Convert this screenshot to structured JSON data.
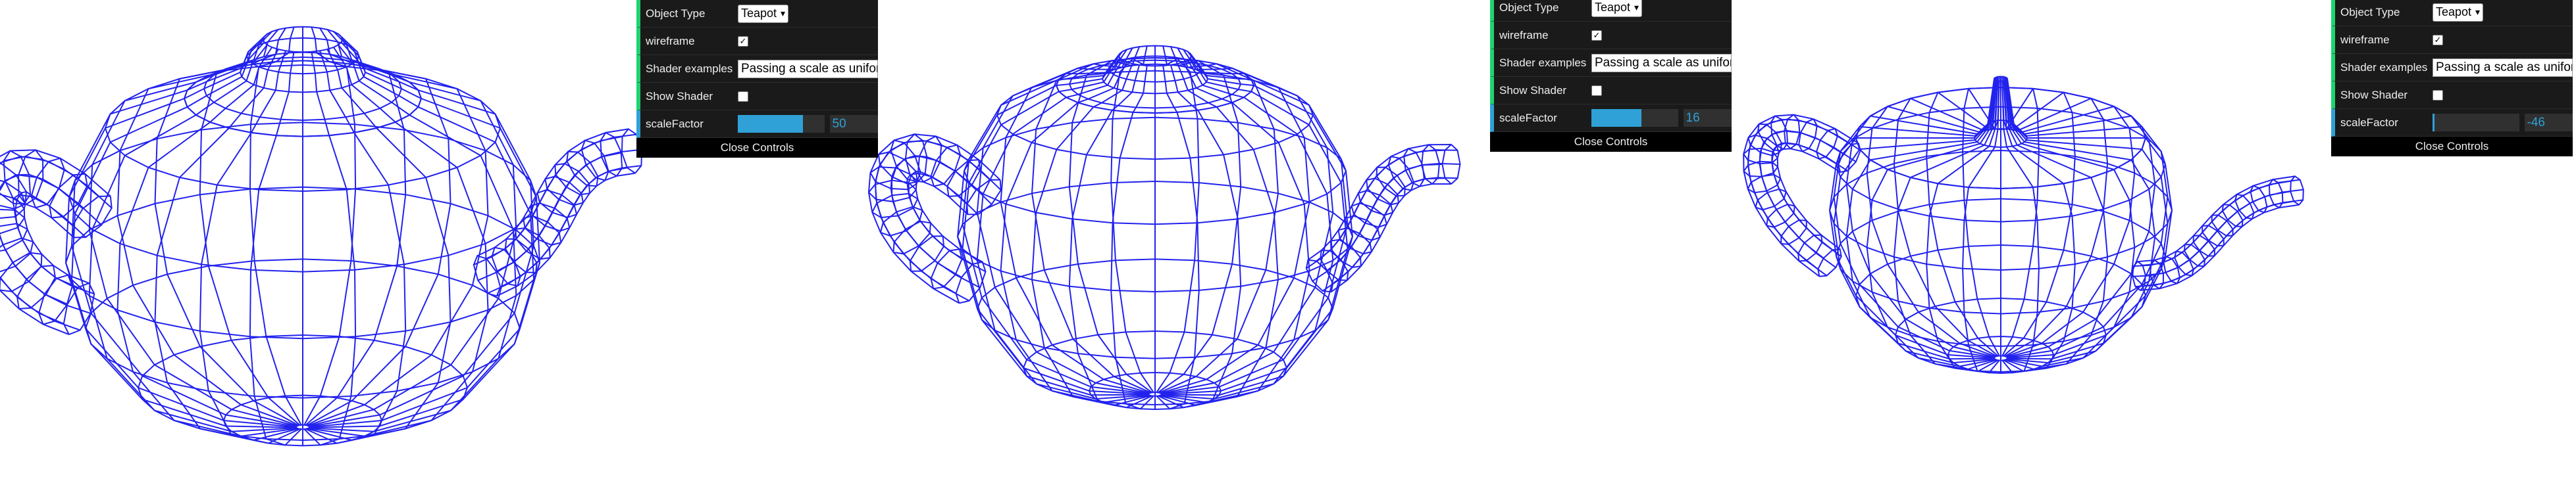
{
  "panels": [
    {
      "object_type_label": "Object Type",
      "object_type_value": "Teapot",
      "wireframe_label": "wireframe",
      "wireframe_checked": true,
      "shader_label": "Shader examples",
      "shader_value": "Passing a scale as uniform",
      "show_shader_label": "Show Shader",
      "show_shader_checked": false,
      "scale_label": "scaleFactor",
      "scale_value": "50",
      "scale_fraction": 0.75,
      "close_label": "Close Controls"
    },
    {
      "object_type_label": "Object Type",
      "object_type_value": "Teapot",
      "wireframe_label": "wireframe",
      "wireframe_checked": true,
      "shader_label": "Shader examples",
      "shader_value": "Passing a scale as uniform",
      "show_shader_label": "Show Shader",
      "show_shader_checked": false,
      "scale_label": "scaleFactor",
      "scale_value": "16",
      "scale_fraction": 0.58,
      "close_label": "Close Controls"
    },
    {
      "object_type_label": "Object Type",
      "object_type_value": "Teapot",
      "wireframe_label": "wireframe",
      "wireframe_checked": true,
      "shader_label": "Shader examples",
      "shader_value": "Passing a scale as uniform",
      "show_shader_label": "Show Shader",
      "show_shader_checked": false,
      "scale_label": "scaleFactor",
      "scale_value": "-46",
      "scale_fraction": 0.02,
      "close_label": "Close Controls"
    }
  ],
  "colors": {
    "wire": "#2222ee",
    "slider_fill": "#2FA1D6",
    "panel_bg": "#1a1a1a"
  },
  "icons": {
    "checkmark": "checkmark-icon",
    "chevron": "chevron-down-icon"
  }
}
